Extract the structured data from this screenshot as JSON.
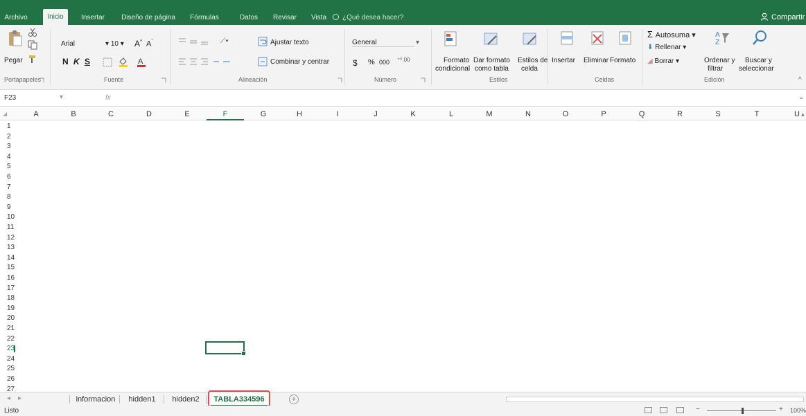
{
  "menu": {
    "tabs": [
      "Archivo",
      "Inicio",
      "Insertar",
      "Diseño de página",
      "Fórmulas",
      "Datos",
      "Revisar",
      "Vista"
    ],
    "tell_me": "¿Qué desea hacer?",
    "share": "Compartir"
  },
  "ribbon": {
    "clipboard": {
      "paste": "Pegar",
      "group": "Portapapeles"
    },
    "font": {
      "name": "Arial",
      "size": "10",
      "bold": "N",
      "italic": "K",
      "underline": "S",
      "group": "Fuente"
    },
    "alignment": {
      "wrap": "Ajustar texto",
      "merge": "Combinar y centrar",
      "group": "Alineación"
    },
    "number": {
      "format": "General",
      "currency": "$",
      "percent": "%",
      "thousands": "000",
      "group": "Número"
    },
    "styles": {
      "conditional_1": "Formato",
      "conditional_2": "condicional",
      "table_1": "Dar formato",
      "table_2": "como tabla",
      "cell_1": "Estilos de",
      "cell_2": "celda",
      "group": "Estilos"
    },
    "cells": {
      "insert": "Insertar",
      "delete": "Eliminar",
      "format": "Formato",
      "group": "Celdas"
    },
    "editing": {
      "autosum": "Autosuma",
      "fill": "Rellenar",
      "clear": "Borrar",
      "sort_1": "Ordenar y",
      "sort_2": "filtrar",
      "find_1": "Buscar y",
      "find_2": "seleccionar",
      "group": "Edición"
    }
  },
  "formula_bar": {
    "name_box": "F23",
    "fx": "fx"
  },
  "grid": {
    "columns": [
      "A",
      "B",
      "C",
      "D",
      "E",
      "F",
      "G",
      "H",
      "I",
      "J",
      "K",
      "L",
      "M",
      "N",
      "O",
      "P",
      "Q",
      "R",
      "S",
      "T",
      "U"
    ],
    "rows": [
      "1",
      "2",
      "3",
      "4",
      "5",
      "6",
      "7",
      "8",
      "9",
      "10",
      "11",
      "12",
      "13",
      "14",
      "15",
      "16",
      "17",
      "18",
      "19",
      "20",
      "21",
      "22",
      "23",
      "24",
      "25",
      "26",
      "27"
    ],
    "selected_column": "F",
    "selected_row": "23"
  },
  "sheets": {
    "tabs": [
      "informacion",
      "hidden1",
      "hidden2",
      "TABLA334596"
    ],
    "active": "TABLA334596",
    "add_label": "+"
  },
  "status": {
    "text": "Listo",
    "zoom": "100%"
  }
}
